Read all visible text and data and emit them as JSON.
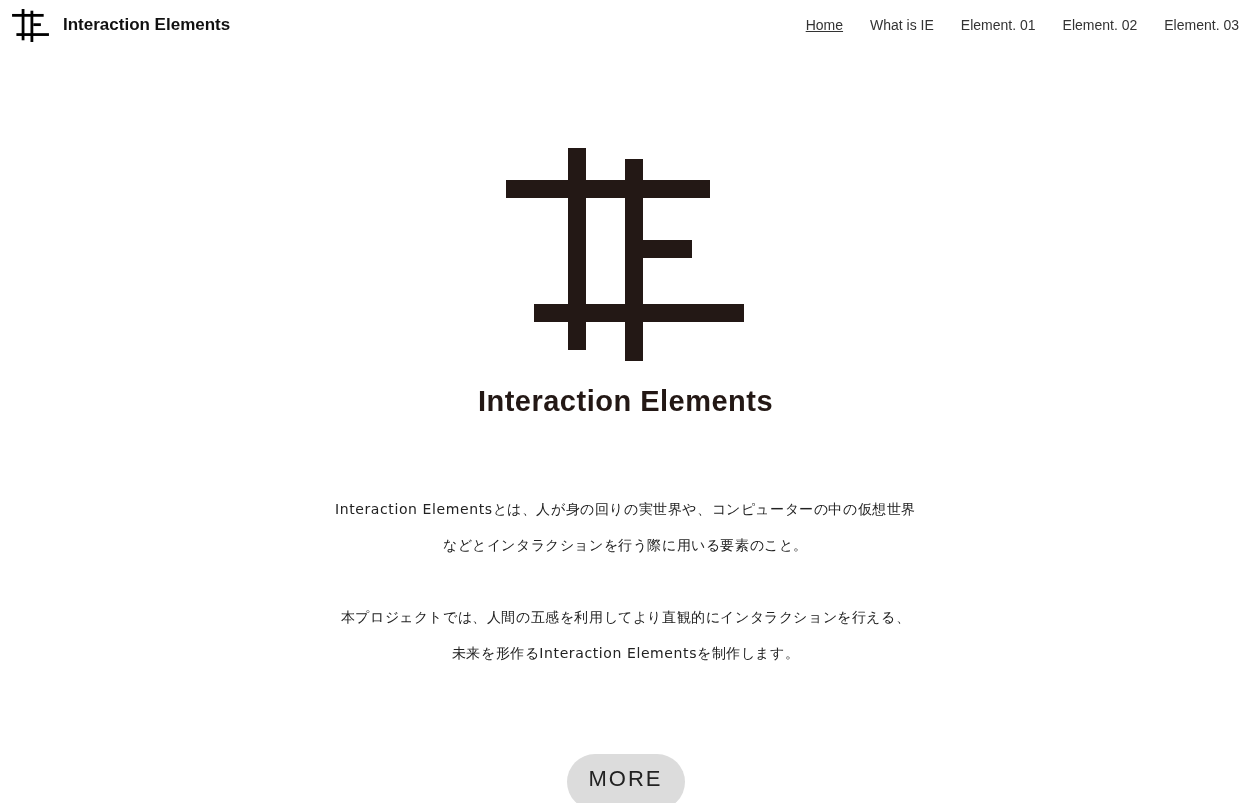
{
  "header": {
    "site_title": "Interaction Elements"
  },
  "nav": [
    {
      "label": "Home",
      "selected": true
    },
    {
      "label": "What is IE",
      "selected": false
    },
    {
      "label": "Element. 01",
      "selected": false
    },
    {
      "label": "Element. 02",
      "selected": false
    },
    {
      "label": "Element. 03",
      "selected": false
    }
  ],
  "hero": {
    "title": "Interaction Elements"
  },
  "paragraphs": [
    [
      "Interaction Elementsとは、人が身の回りの実世界や、コンピューターの中の仮想世界",
      "などとインタラクションを行う際に用いる要素のこと。"
    ],
    [
      "本プロジェクトでは、人間の五感を利用してより直観的にインタラクションを行える、",
      "未来を形作るInteraction Elementsを制作します。"
    ]
  ],
  "more_button": "MORE"
}
